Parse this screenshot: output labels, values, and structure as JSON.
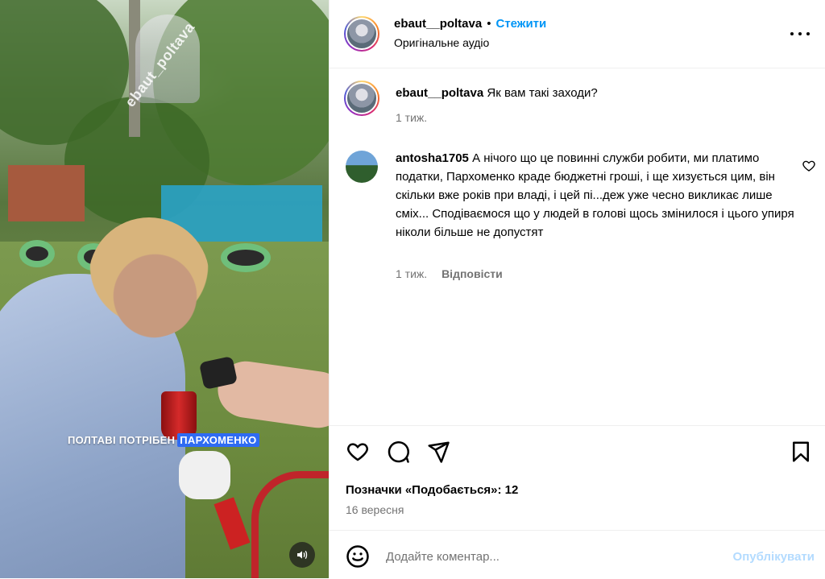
{
  "post": {
    "username": "ebaut__poltava",
    "separator": "•",
    "follow_label": "Стежити",
    "audio": "Оригінальне аудіо"
  },
  "media": {
    "watermark": "ebaut_poltava",
    "caption_prefix": "ПОЛТАВІ ПОТРІБЕН",
    "caption_highlight": "ПАРХОМЕНКО"
  },
  "comments": [
    {
      "username": "ebaut__poltava",
      "text": "Як вам такі заходи?",
      "time": "1 тиж."
    },
    {
      "username": "antosha1705",
      "text": "А нічого що це повинні служби робити, ми платимо податки, Пархоменко краде бюджетні гроші, і ще хизується цим, він скільки вже років при владі, і цей пі...деж уже чесно викликає лише сміх... Сподіваємося що у людей в голові щось змінилося і цього упиря ніколи більше не допустят",
      "time": "1 тиж.",
      "reply_label": "Відповісти"
    }
  ],
  "actions": {
    "likes": "Позначки «Подобається»: 12",
    "date": "16 вересня"
  },
  "comment_box": {
    "placeholder": "Додайте коментар...",
    "publish_label": "Опублікувати"
  },
  "icons": [
    "heart-icon",
    "comment-icon",
    "share-icon",
    "bookmark-icon",
    "emoji-icon",
    "more-icon",
    "volume-icon"
  ]
}
